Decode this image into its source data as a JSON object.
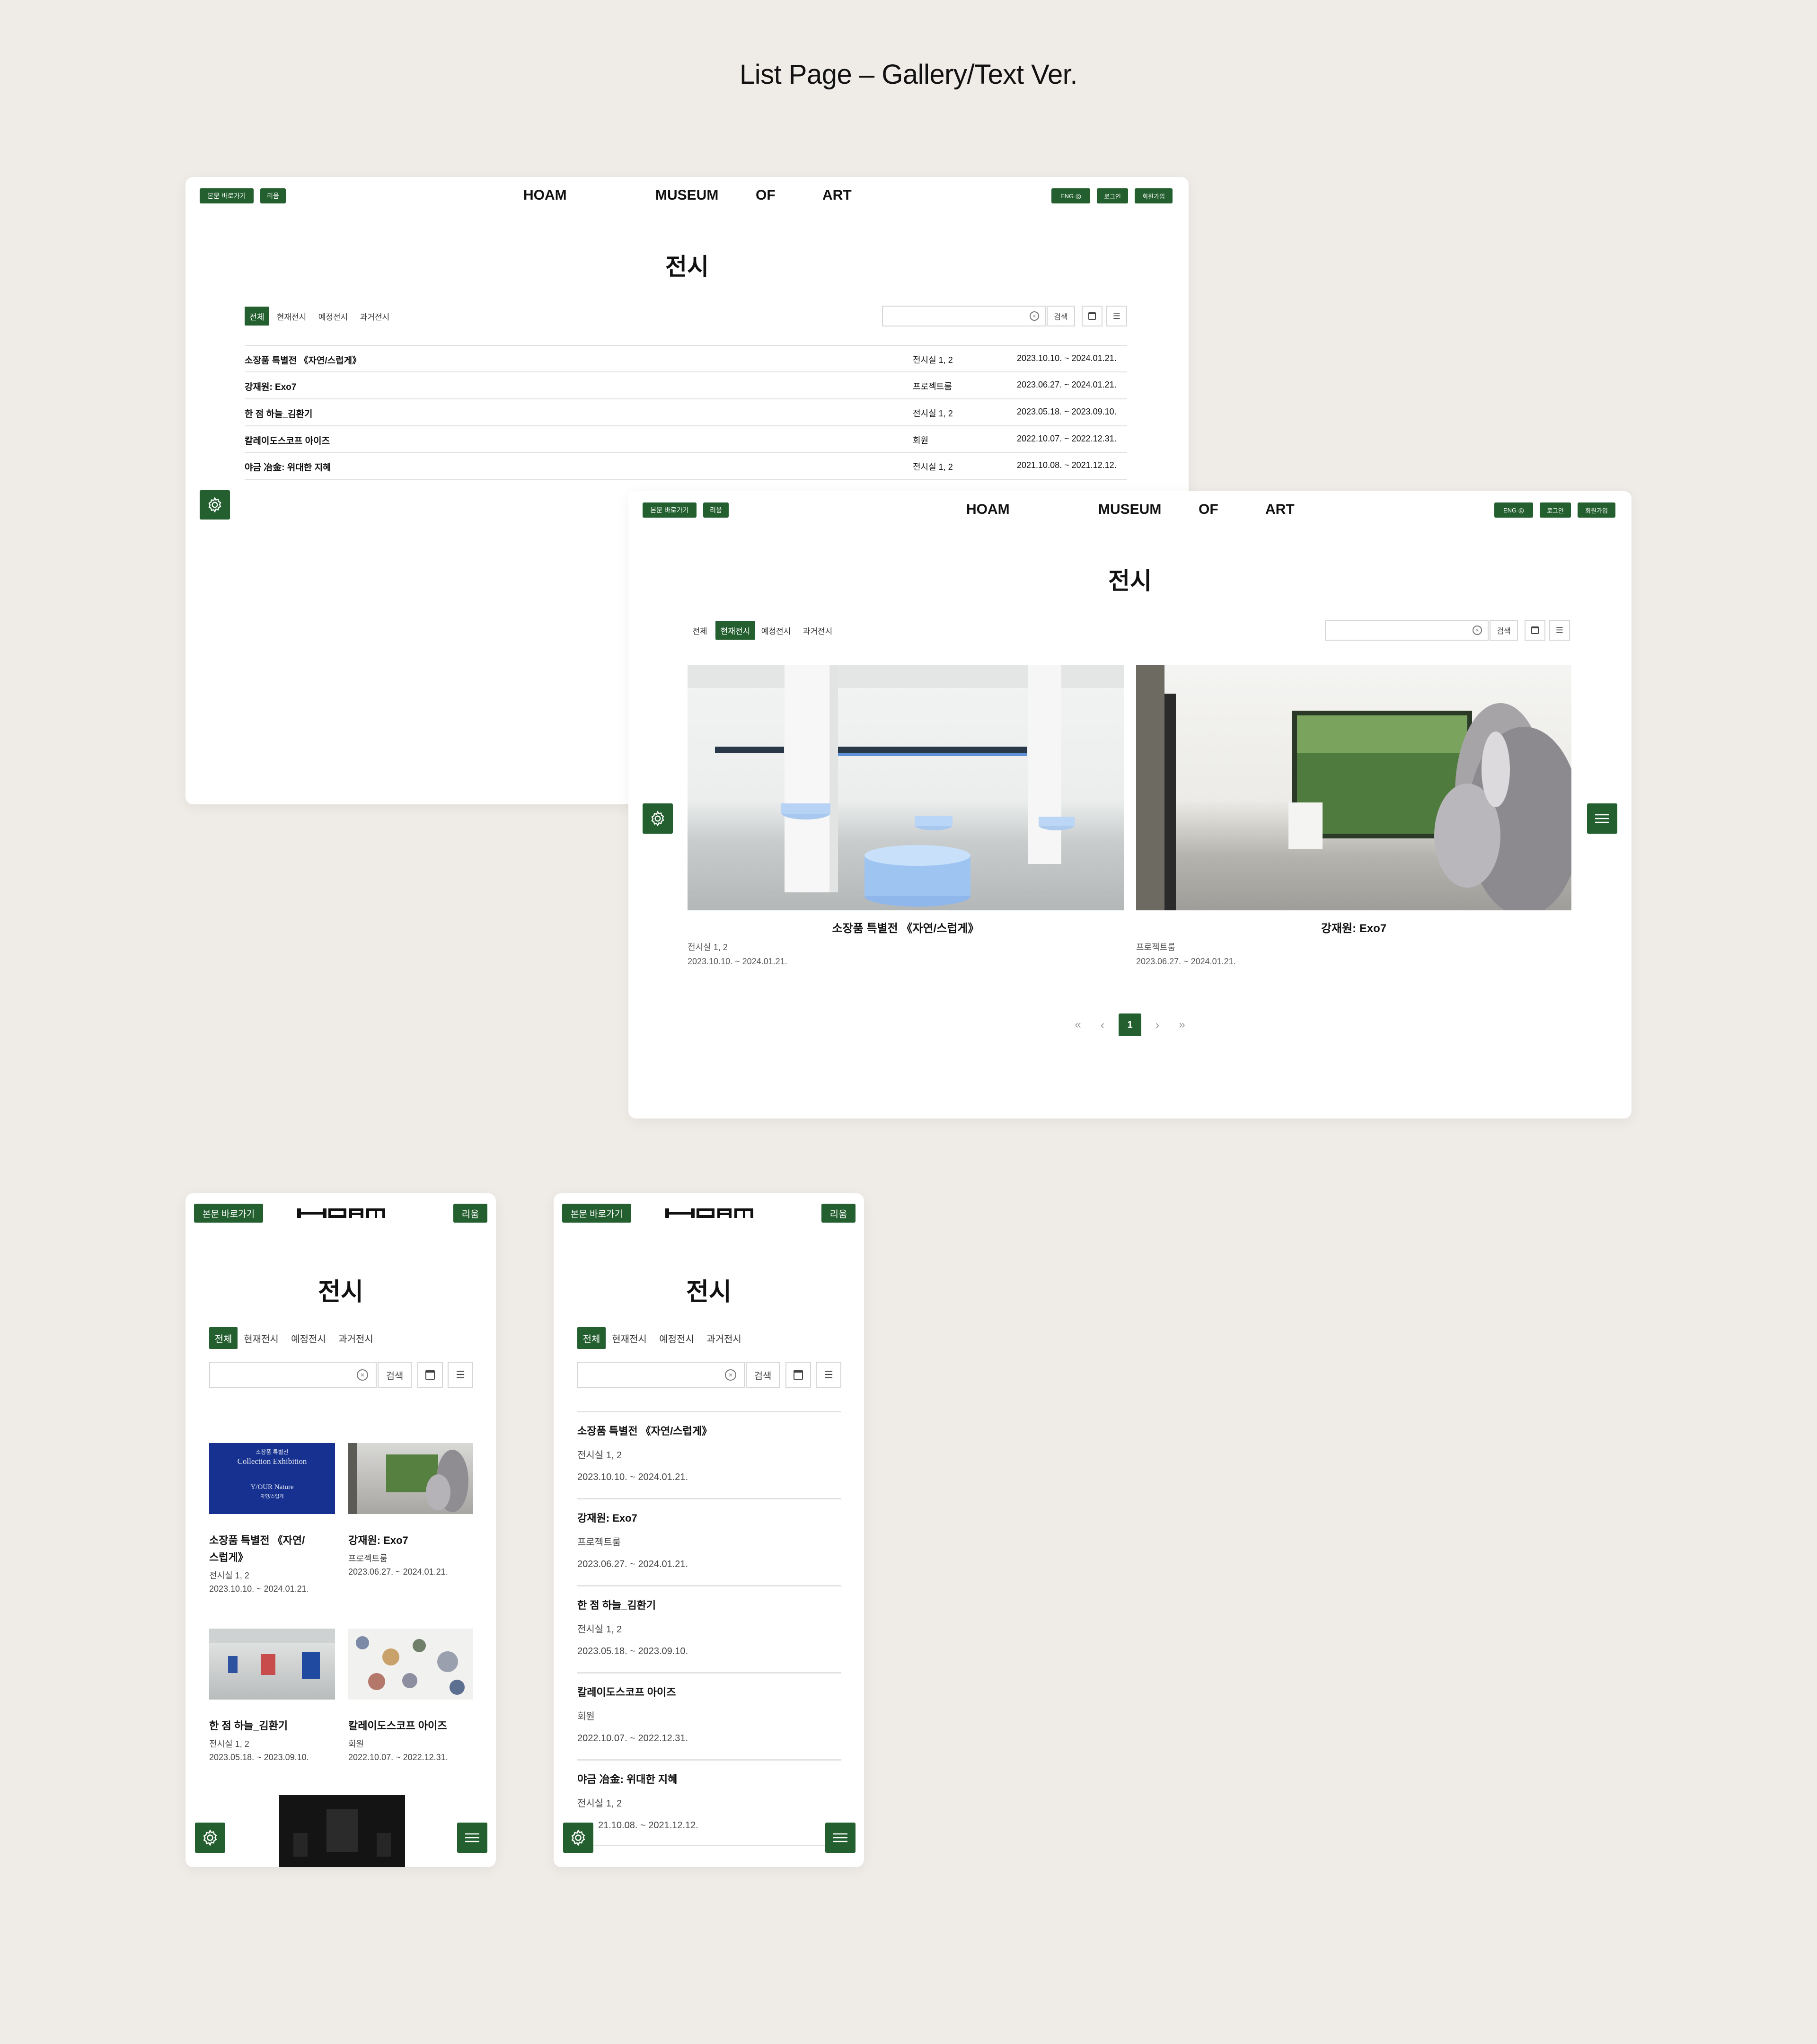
{
  "heading": "List Page – Gallery/Text Ver.",
  "nav": {
    "skip": "본문 바로가기",
    "ripple": "리움",
    "words": [
      "HOAM",
      "MUSEUM",
      "OF",
      "ART"
    ],
    "eng": "ENG",
    "login": "로그인",
    "signup": "회원가입",
    "logo_text": "HOAM"
  },
  "page_title": "전시",
  "tabs": [
    "전체",
    "현재전시",
    "예정전시",
    "과거전시"
  ],
  "search_button": "검색",
  "exhibitions": [
    {
      "title": "소장품 특별전 《자연/스럽게》",
      "place": "전시실 1, 2",
      "date": "2023.10.10. ~ 2024.01.21."
    },
    {
      "title": "강재원: Exo7",
      "place": "프로젝트룸",
      "date": "2023.06.27. ~ 2024.01.21."
    },
    {
      "title": "한 점 하늘_김환기",
      "place": "전시실 1, 2",
      "date": "2023.05.18. ~ 2023.09.10."
    },
    {
      "title": "칼레이도스코프 아이즈",
      "place": "회원",
      "date": "2022.10.07. ~ 2022.12.31."
    },
    {
      "title": "야금 冶金: 위대한 지혜",
      "place": "전시실 1, 2",
      "date": "2021.10.08. ~ 2021.12.12."
    }
  ],
  "mobile_cards": [
    {
      "title_line1": "소장품 특별전 《자연/",
      "title_line2": "스럽게》"
    },
    {
      "title_line1": "강재원: Exo7",
      "title_line2": ""
    }
  ],
  "poster": {
    "line1": "소장품 특별전",
    "line2": "Collection Exhibition",
    "line3": "Y/OUR Nature",
    "line4": "자연/스럽게"
  },
  "mobile_last_date": "21.10.08. ~ 2021.12.12.",
  "pagination": {
    "first": "«",
    "prev": "‹",
    "current": "1",
    "next": "›",
    "last": "»"
  },
  "colors": {
    "brand_green": "#245f2f",
    "background": "#efebe7"
  },
  "icons": [
    "settings-icon",
    "menu-icon",
    "calendar-icon",
    "list-icon",
    "clear-icon",
    "globe-icon"
  ]
}
